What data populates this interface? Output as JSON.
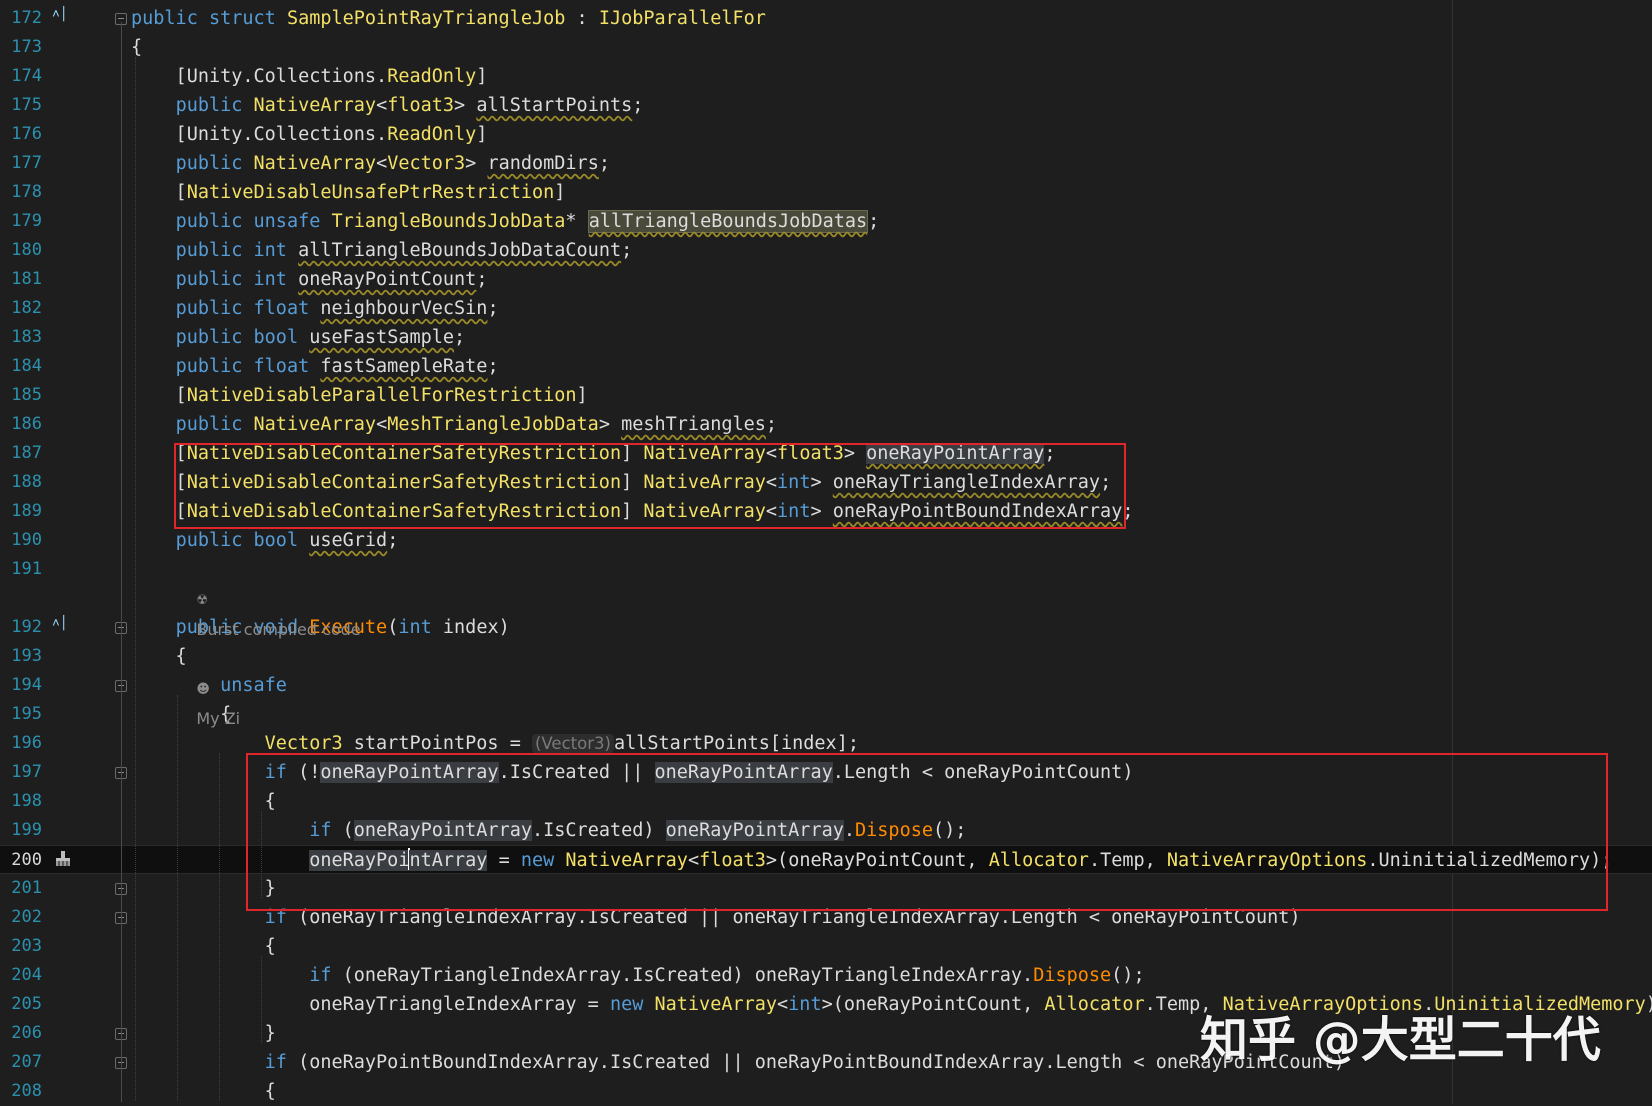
{
  "editor": {
    "lines": [
      {
        "num": "172",
        "tokens": [
          [
            "kw",
            "public "
          ],
          [
            "kw",
            "struct "
          ],
          [
            "st",
            "SamplePointRayTriangleJob"
          ],
          [
            "pl",
            " : "
          ],
          [
            "st",
            "IJobParallelFor"
          ]
        ]
      },
      {
        "num": "173",
        "tokens": [
          [
            "pl",
            "{"
          ]
        ]
      },
      {
        "num": "174",
        "tokens": [
          [
            "pl",
            "    [Unity.Collections."
          ],
          [
            "st",
            "ReadOnly"
          ],
          [
            "pl",
            "]"
          ]
        ]
      },
      {
        "num": "175",
        "tokens": [
          [
            "pl",
            "    "
          ],
          [
            "kw",
            "public "
          ],
          [
            "st",
            "NativeArray"
          ],
          [
            "pl",
            "<"
          ],
          [
            "st",
            "float3"
          ],
          [
            "pl",
            "> "
          ],
          [
            "uw",
            "allStartPoints"
          ],
          [
            "pl",
            ";"
          ]
        ]
      },
      {
        "num": "176",
        "tokens": [
          [
            "pl",
            "    [Unity.Collections."
          ],
          [
            "st",
            "ReadOnly"
          ],
          [
            "pl",
            "]"
          ]
        ]
      },
      {
        "num": "177",
        "tokens": [
          [
            "pl",
            "    "
          ],
          [
            "kw",
            "public "
          ],
          [
            "st",
            "NativeArray"
          ],
          [
            "pl",
            "<"
          ],
          [
            "st",
            "Vector3"
          ],
          [
            "pl",
            "> "
          ],
          [
            "uw",
            "randomDirs"
          ],
          [
            "pl",
            ";"
          ]
        ]
      },
      {
        "num": "178",
        "tokens": [
          [
            "pl",
            "    ["
          ],
          [
            "st",
            "NativeDisableUnsafePtrRestriction"
          ],
          [
            "pl",
            "]"
          ]
        ]
      },
      {
        "num": "179",
        "tokens": [
          [
            "pl",
            "    "
          ],
          [
            "kw",
            "public "
          ],
          [
            "kw",
            "unsafe "
          ],
          [
            "st",
            "TriangleBoundsJobData"
          ],
          [
            "pl",
            "* "
          ],
          [
            "uwhl2",
            "allTriangleBoundsJobDatas"
          ],
          [
            "pl",
            ";"
          ]
        ]
      },
      {
        "num": "180",
        "tokens": [
          [
            "pl",
            "    "
          ],
          [
            "kw",
            "public "
          ],
          [
            "kw",
            "int "
          ],
          [
            "uw",
            "allTriangleBoundsJobDataCount"
          ],
          [
            "pl",
            ";"
          ]
        ]
      },
      {
        "num": "181",
        "tokens": [
          [
            "pl",
            "    "
          ],
          [
            "kw",
            "public "
          ],
          [
            "kw",
            "int "
          ],
          [
            "uw",
            "oneRayPointCount"
          ],
          [
            "pl",
            ";"
          ]
        ]
      },
      {
        "num": "182",
        "tokens": [
          [
            "pl",
            "    "
          ],
          [
            "kw",
            "public "
          ],
          [
            "kw",
            "float "
          ],
          [
            "uw",
            "neighbourVecSin"
          ],
          [
            "pl",
            ";"
          ]
        ]
      },
      {
        "num": "183",
        "tokens": [
          [
            "pl",
            "    "
          ],
          [
            "kw",
            "public "
          ],
          [
            "kw",
            "bool "
          ],
          [
            "uw",
            "useFastSample"
          ],
          [
            "pl",
            ";"
          ]
        ]
      },
      {
        "num": "184",
        "tokens": [
          [
            "pl",
            "    "
          ],
          [
            "kw",
            "public "
          ],
          [
            "kw",
            "float "
          ],
          [
            "uw",
            "fastSamepleRate"
          ],
          [
            "pl",
            ";"
          ]
        ]
      },
      {
        "num": "185",
        "tokens": [
          [
            "pl",
            "    ["
          ],
          [
            "st",
            "NativeDisableParallelForRestriction"
          ],
          [
            "pl",
            "]"
          ]
        ]
      },
      {
        "num": "186",
        "tokens": [
          [
            "pl",
            "    "
          ],
          [
            "kw",
            "public "
          ],
          [
            "st",
            "NativeArray"
          ],
          [
            "pl",
            "<"
          ],
          [
            "st",
            "MeshTriangleJobData"
          ],
          [
            "pl",
            "> "
          ],
          [
            "uw",
            "meshTriangles"
          ],
          [
            "pl",
            ";"
          ]
        ]
      },
      {
        "num": "187",
        "tokens": [
          [
            "pl",
            "    ["
          ],
          [
            "st",
            "NativeDisableContainerSafetyRestriction"
          ],
          [
            "pl",
            "] "
          ],
          [
            "st",
            "NativeArray"
          ],
          [
            "pl",
            "<"
          ],
          [
            "st",
            "float3"
          ],
          [
            "pl",
            "> "
          ],
          [
            "uwhl",
            "oneRayPointArray"
          ],
          [
            "pl",
            ";"
          ]
        ]
      },
      {
        "num": "188",
        "tokens": [
          [
            "pl",
            "    ["
          ],
          [
            "st",
            "NativeDisableContainerSafetyRestriction"
          ],
          [
            "pl",
            "] "
          ],
          [
            "st",
            "NativeArray"
          ],
          [
            "pl",
            "<"
          ],
          [
            "kw",
            "int"
          ],
          [
            "pl",
            "> "
          ],
          [
            "uw",
            "oneRayTriangleIndexArray"
          ],
          [
            "pl",
            ";"
          ]
        ]
      },
      {
        "num": "189",
        "tokens": [
          [
            "pl",
            "    ["
          ],
          [
            "st",
            "NativeDisableContainerSafetyRestriction"
          ],
          [
            "pl",
            "] "
          ],
          [
            "st",
            "NativeArray"
          ],
          [
            "pl",
            "<"
          ],
          [
            "kw",
            "int"
          ],
          [
            "pl",
            "> "
          ],
          [
            "uw",
            "oneRayPointBoundIndexArray"
          ],
          [
            "pl",
            ";"
          ]
        ]
      },
      {
        "num": "190",
        "tokens": [
          [
            "pl",
            "    "
          ],
          [
            "kw",
            "public "
          ],
          [
            "kw",
            "bool "
          ],
          [
            "uw",
            "useGrid"
          ],
          [
            "pl",
            ";"
          ]
        ]
      },
      {
        "num": "191",
        "tokens": []
      },
      {
        "num": "192",
        "tokens": [
          [
            "pl",
            "    "
          ],
          [
            "kw",
            "public "
          ],
          [
            "kw",
            "void "
          ],
          [
            "me",
            "Execute"
          ],
          [
            "pl",
            "("
          ],
          [
            "kw",
            "int "
          ],
          [
            "pl",
            "index)"
          ]
        ]
      },
      {
        "num": "193",
        "tokens": [
          [
            "pl",
            "    {"
          ]
        ]
      },
      {
        "num": "194",
        "tokens": [
          [
            "pl",
            "        "
          ],
          [
            "kw",
            "unsafe"
          ]
        ]
      },
      {
        "num": "195",
        "tokens": [
          [
            "pl",
            "        {"
          ]
        ]
      },
      {
        "num": "196",
        "tokens": [
          [
            "pl",
            "            "
          ],
          [
            "st",
            "Vector3"
          ],
          [
            "pl",
            " startPointPos = "
          ],
          [
            "hint",
            "(Vector3)"
          ],
          [
            "pl",
            "allStartPoints[index];"
          ]
        ]
      },
      {
        "num": "197",
        "tokens": [
          [
            "pl",
            "            "
          ],
          [
            "kw",
            "if "
          ],
          [
            "pl",
            "(!"
          ],
          [
            "hl",
            "oneRayPointArray"
          ],
          [
            "pl",
            ".IsCreated || "
          ],
          [
            "hl",
            "oneRayPointArray"
          ],
          [
            "pl",
            ".Length < oneRayPointCount)"
          ]
        ]
      },
      {
        "num": "198",
        "tokens": [
          [
            "pl",
            "            {"
          ]
        ]
      },
      {
        "num": "199",
        "tokens": [
          [
            "pl",
            "                "
          ],
          [
            "kw",
            "if "
          ],
          [
            "pl",
            "("
          ],
          [
            "hl",
            "oneRayPointArray"
          ],
          [
            "pl",
            ".IsCreated) "
          ],
          [
            "hl",
            "oneRayPointArray"
          ],
          [
            "pl",
            "."
          ],
          [
            "me",
            "Dispose"
          ],
          [
            "pl",
            "();"
          ]
        ]
      },
      {
        "num": "200",
        "tokens": [
          [
            "pl",
            "                "
          ],
          [
            "hl",
            "oneRayPoi"
          ],
          [
            "caret",
            ""
          ],
          [
            "hl",
            "ntArray"
          ],
          [
            "pl",
            " = "
          ],
          [
            "kw",
            "new "
          ],
          [
            "st",
            "NativeArray"
          ],
          [
            "pl",
            "<"
          ],
          [
            "st",
            "float3"
          ],
          [
            "pl",
            ">(oneRayPointCount, "
          ],
          [
            "st",
            "Allocator"
          ],
          [
            "pl",
            ".Temp, "
          ],
          [
            "st",
            "NativeArrayOptions"
          ],
          [
            "pl",
            ".UninitializedMemory);"
          ]
        ]
      },
      {
        "num": "201",
        "tokens": [
          [
            "pl",
            "            }"
          ]
        ]
      },
      {
        "num": "202",
        "tokens": [
          [
            "pl",
            "            "
          ],
          [
            "kw",
            "if "
          ],
          [
            "pl",
            "(oneRayTriangleIndexArray.IsCreated || oneRayTriangleIndexArray.Length < oneRayPointCount)"
          ]
        ]
      },
      {
        "num": "203",
        "tokens": [
          [
            "pl",
            "            {"
          ]
        ]
      },
      {
        "num": "204",
        "tokens": [
          [
            "pl",
            "                "
          ],
          [
            "kw",
            "if "
          ],
          [
            "pl",
            "(oneRayTriangleIndexArray.IsCreated) oneRayTriangleIndexArray."
          ],
          [
            "me",
            "Dispose"
          ],
          [
            "pl",
            "();"
          ]
        ]
      },
      {
        "num": "205",
        "tokens": [
          [
            "pl",
            "                oneRayTriangleIndexArray = "
          ],
          [
            "kw",
            "new "
          ],
          [
            "st",
            "NativeArray"
          ],
          [
            "pl",
            "<"
          ],
          [
            "kw",
            "int"
          ],
          [
            "pl",
            ">(oneRayPointCount, "
          ],
          [
            "st",
            "Allocator"
          ],
          [
            "pl",
            ".Temp, "
          ],
          [
            "st",
            "NativeArrayOptions"
          ],
          [
            "pl",
            "."
          ],
          [
            "st",
            "UninitializedMemory"
          ],
          [
            "pl",
            ");"
          ]
        ]
      },
      {
        "num": "206",
        "tokens": [
          [
            "pl",
            "            }"
          ]
        ]
      },
      {
        "num": "207",
        "tokens": [
          [
            "pl",
            "            "
          ],
          [
            "kw",
            "if "
          ],
          [
            "pl",
            "(oneRayPointBoundIndexArray.IsCreated || oneRayPointBoundIndexArray.Length < oneRayPointCount)"
          ]
        ]
      },
      {
        "num": "208",
        "tokens": [
          [
            "pl",
            "            {"
          ]
        ]
      }
    ],
    "codelens": {
      "burst_label": "Burst compiled code",
      "author_label": "My Zi"
    },
    "current_line": "200",
    "colors": {
      "background": "#1e1e1e",
      "keyword": "#569cd6",
      "type": "#f3e066",
      "method": "#ff8c00",
      "line_number": "#2b91af",
      "annotation_box": "#e0262a"
    },
    "icons": {
      "bookmark": "bookmark-up-icon",
      "breakpoint_tool": "brush-icon",
      "codelens_burst": "burst-icon",
      "codelens_author": "user-icon"
    }
  },
  "watermark": "知乎 @大型二十代"
}
